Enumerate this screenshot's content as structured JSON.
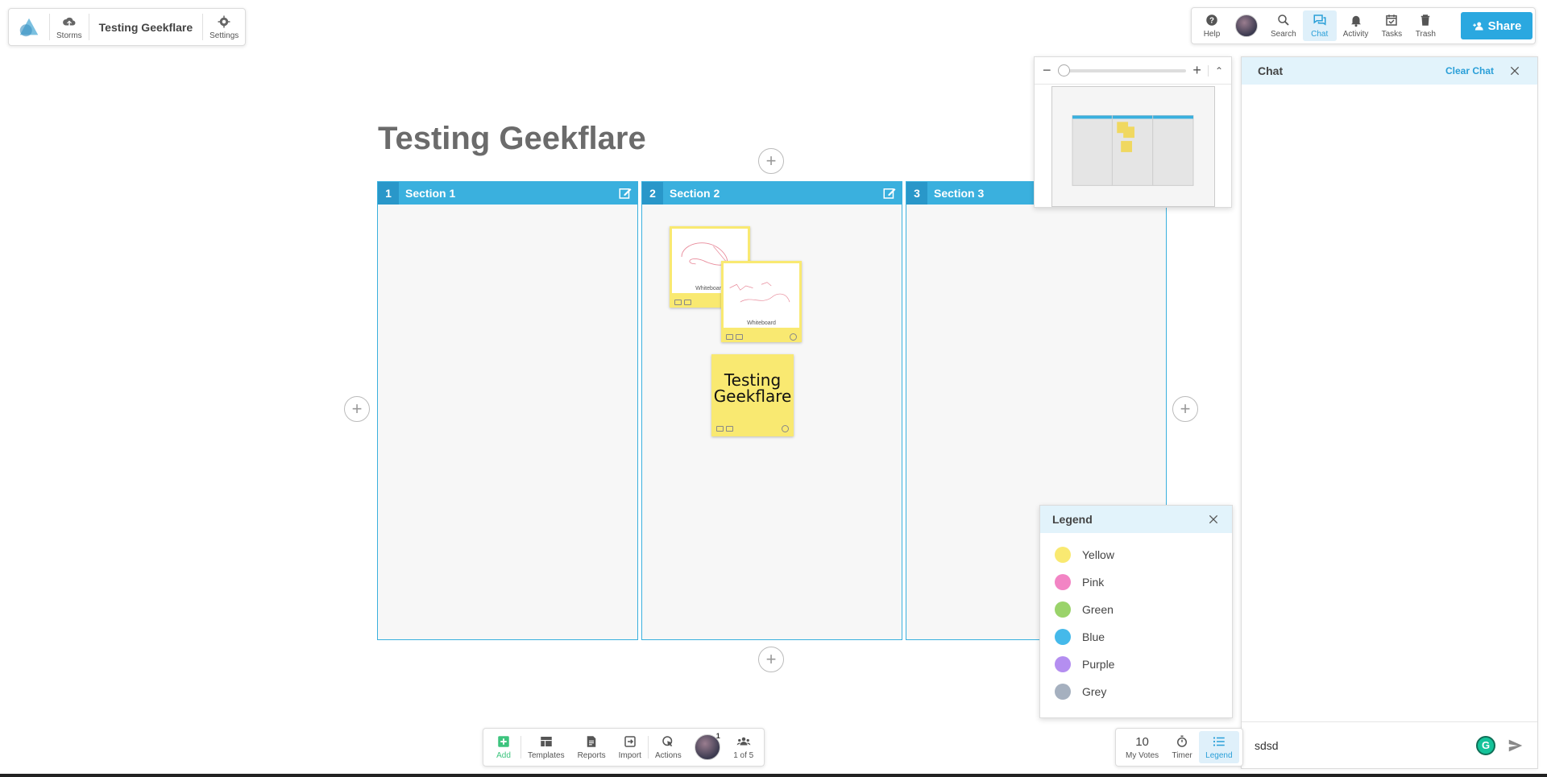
{
  "topleft": {
    "storms_label": "Storms",
    "board_name": "Testing Geekflare",
    "settings_label": "Settings"
  },
  "topright": {
    "help_label": "Help",
    "search_label": "Search",
    "chat_label": "Chat",
    "activity_label": "Activity",
    "tasks_label": "Tasks",
    "trash_label": "Trash",
    "share_label": "Share"
  },
  "board": {
    "title": "Testing Geekflare",
    "sections": [
      {
        "num": "1",
        "title": "Section 1"
      },
      {
        "num": "2",
        "title": "Section 2"
      },
      {
        "num": "3",
        "title": "Section 3"
      }
    ],
    "cards": {
      "wb1_label": "Whiteboard",
      "wb2_label": "Whiteboard",
      "text_card": "Testing Geekflare"
    }
  },
  "chat": {
    "title": "Chat",
    "clear_label": "Clear Chat",
    "input_value": "sdsd"
  },
  "legend": {
    "title": "Legend",
    "items": [
      {
        "label": "Yellow",
        "color": "#f9e971"
      },
      {
        "label": "Pink",
        "color": "#f284c4"
      },
      {
        "label": "Green",
        "color": "#9ad36a"
      },
      {
        "label": "Blue",
        "color": "#45b9ea"
      },
      {
        "label": "Purple",
        "color": "#b48ef0"
      },
      {
        "label": "Grey",
        "color": "#a5b0bf"
      }
    ]
  },
  "bottom_toolbar": {
    "add_label": "Add",
    "templates_label": "Templates",
    "reports_label": "Reports",
    "import_label": "Import",
    "actions_label": "Actions",
    "avatar_badge": "1",
    "users_label": "1 of 5"
  },
  "votes_toolbar": {
    "votes_count": "10",
    "votes_label": "My Votes",
    "timer_label": "Timer",
    "legend_label": "Legend"
  },
  "colors": {
    "accent": "#3ab0de",
    "card_yellow": "#f9e971",
    "add_green": "#3dc47e"
  }
}
